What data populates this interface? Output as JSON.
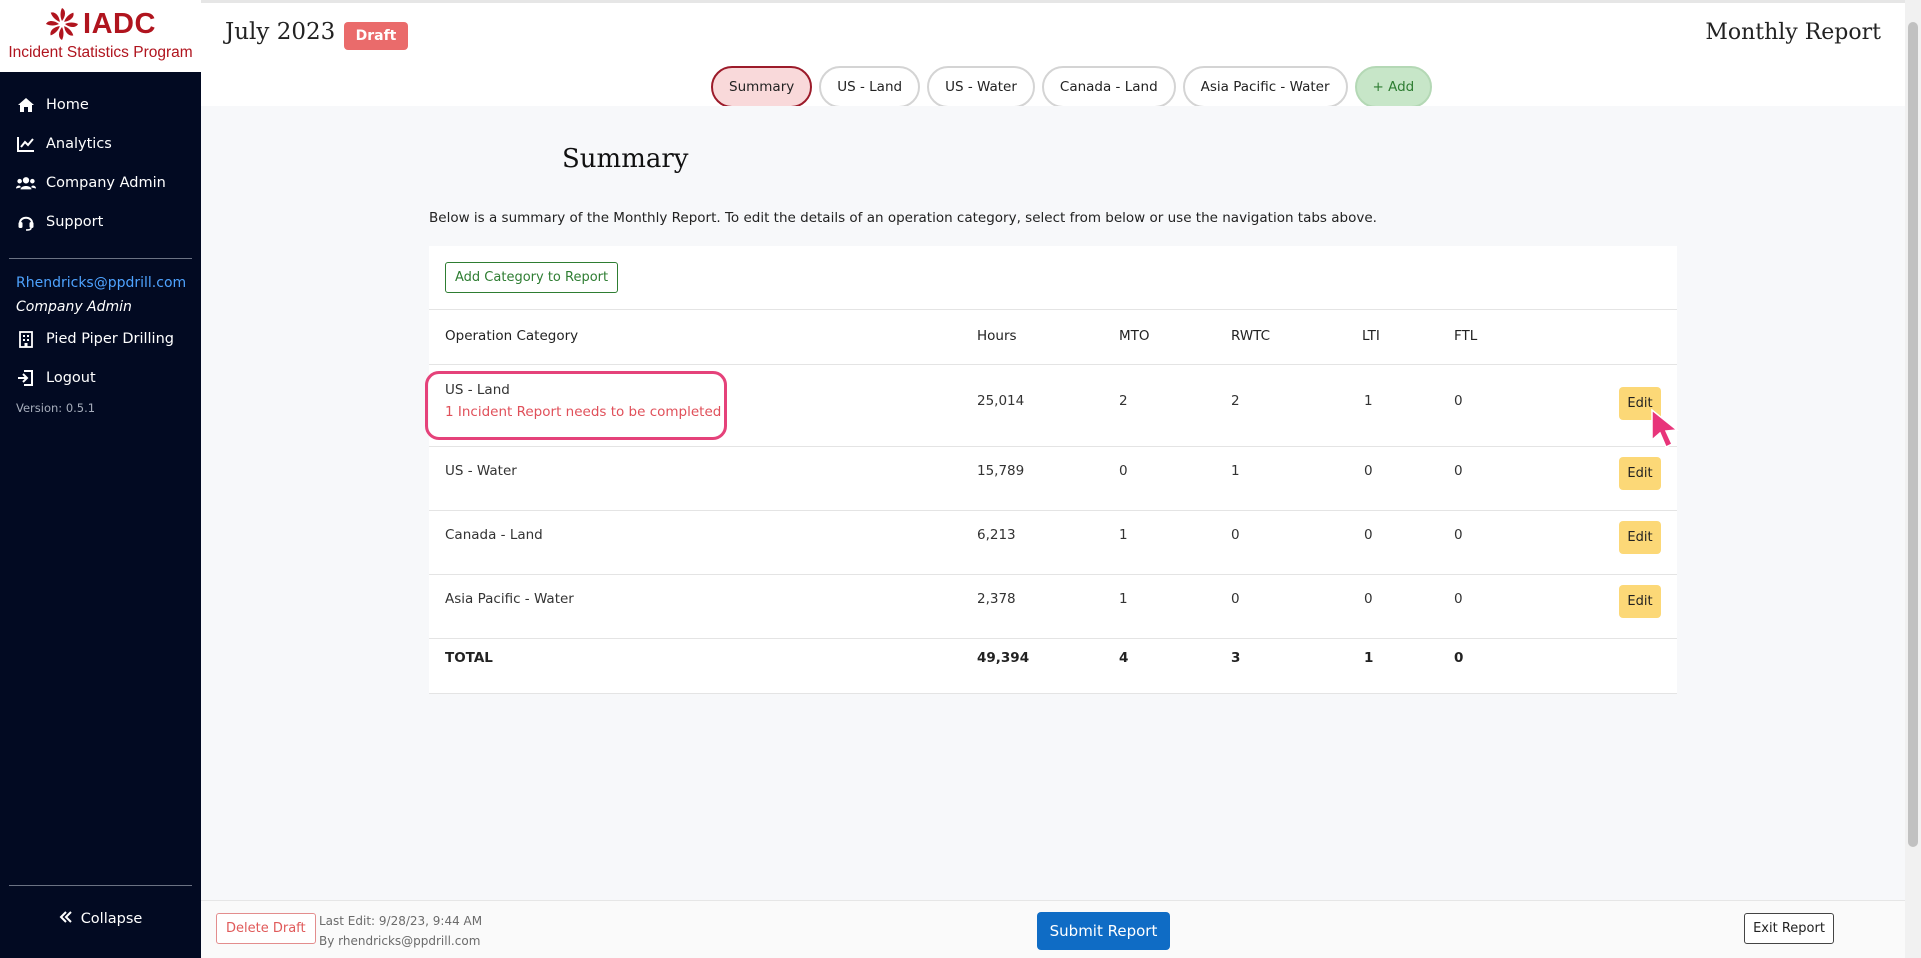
{
  "sidebar": {
    "logo_text": "IADC",
    "logo_subtitle": "Incident Statistics Program",
    "nav": [
      {
        "label": "Home",
        "icon": "home-icon"
      },
      {
        "label": "Analytics",
        "icon": "chart-line-icon"
      },
      {
        "label": "Company Admin",
        "icon": "users-icon"
      },
      {
        "label": "Support",
        "icon": "headset-icon"
      }
    ],
    "user_email": "Rhendricks@ppdrill.com",
    "user_role": "Company Admin",
    "company": "Pied Piper Drilling",
    "logout": "Logout",
    "version": "Version: 0.5.1",
    "collapse": "Collapse"
  },
  "header": {
    "title": "July 2023",
    "badge": "Draft",
    "right_title": "Monthly Report",
    "tabs": [
      {
        "label": "Summary",
        "active": true
      },
      {
        "label": "US - Land",
        "active": false
      },
      {
        "label": "US - Water",
        "active": false
      },
      {
        "label": "Canada - Land",
        "active": false
      },
      {
        "label": "Asia Pacific - Water",
        "active": false
      },
      {
        "label": "+ Add",
        "active": false
      }
    ]
  },
  "main": {
    "heading": "Summary",
    "intro": "Below is a summary of the Monthly Report. To edit the details of an operation category, select from below or use the navigation tabs above.",
    "add_category": "Add Category to Report",
    "columns": [
      "Operation Category",
      "Hours",
      "MTO",
      "RWTC",
      "LTI",
      "FTL"
    ],
    "rows": [
      {
        "category": "US - Land",
        "warning": "1 Incident Report needs to be completed",
        "hours": "25,014",
        "mto": "2",
        "rwtc": "2",
        "lti": "1",
        "ftl": "0",
        "edit": "Edit"
      },
      {
        "category": "US - Water",
        "hours": "15,789",
        "mto": "0",
        "rwtc": "1",
        "lti": "0",
        "ftl": "0",
        "edit": "Edit"
      },
      {
        "category": "Canada - Land",
        "hours": "6,213",
        "mto": "1",
        "rwtc": "0",
        "lti": "0",
        "ftl": "0",
        "edit": "Edit"
      },
      {
        "category": "Asia Pacific - Water",
        "hours": "2,378",
        "mto": "1",
        "rwtc": "0",
        "lti": "0",
        "ftl": "0",
        "edit": "Edit"
      }
    ],
    "total": {
      "label": "TOTAL",
      "hours": "49,394",
      "mto": "4",
      "rwtc": "3",
      "lti": "1",
      "ftl": "0"
    }
  },
  "footer": {
    "delete_draft": "Delete Draft",
    "last_edit": "Last Edit: 9/28/23, 9:44 AM",
    "edited_by": "By rhendricks@ppdrill.com",
    "submit": "Submit Report",
    "exit": "Exit Report"
  },
  "colors": {
    "sidebar_bg": "#020a22",
    "brand_red": "#b0141e",
    "draft_badge": "#ea6b6b",
    "edit_button": "#fcd877",
    "submit_button": "#0f6cc5",
    "highlight": "#e5427a",
    "warning_text": "#e0505a"
  }
}
